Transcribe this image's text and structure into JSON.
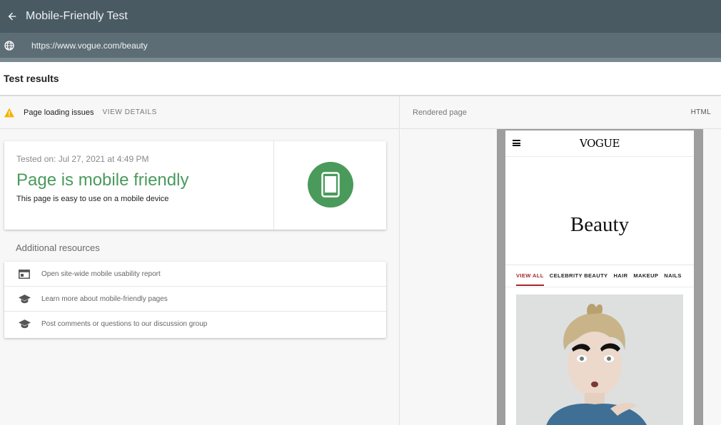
{
  "app": {
    "title": "Mobile-Friendly Test"
  },
  "urlbar": {
    "url": "https://www.vogue.com/beauty"
  },
  "results": {
    "title": "Test results",
    "issues_text": "Page loading issues",
    "view_details": "VIEW DETAILS"
  },
  "card": {
    "tested_on": "Tested on: Jul 27, 2021 at 4:49 PM",
    "verdict": "Page is mobile friendly",
    "subtext": "This page is easy to use on a mobile device",
    "accent_color": "#4a9a5c"
  },
  "resources": {
    "title": "Additional resources",
    "items": [
      {
        "label": "Open site-wide mobile usability report",
        "icon": "report-icon"
      },
      {
        "label": "Learn more about mobile-friendly pages",
        "icon": "school-icon"
      },
      {
        "label": "Post comments or questions to our discussion group",
        "icon": "school-icon"
      }
    ]
  },
  "rendered": {
    "label": "Rendered page",
    "html_tab": "HTML",
    "site": {
      "logo": "VOGUE",
      "heading": "Beauty",
      "nav": [
        "VIEW ALL",
        "CELEBRITY BEAUTY",
        "HAIR",
        "MAKEUP",
        "NAILS"
      ],
      "nav_active_color": "#a3272d"
    }
  }
}
